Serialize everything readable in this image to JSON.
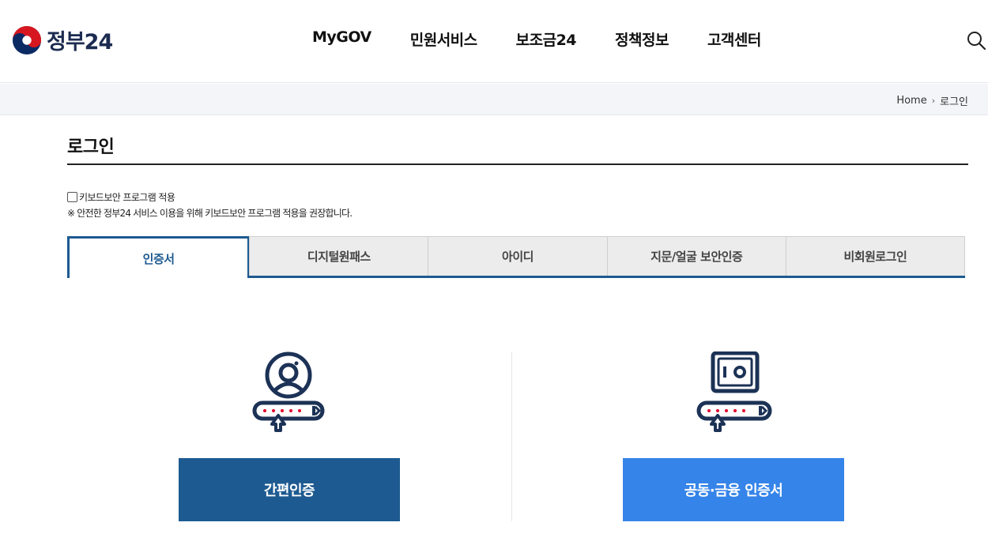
{
  "header": {
    "logo_text": "정부24",
    "nav": [
      "MyGOV",
      "민원서비스",
      "보조금24",
      "정책정보",
      "고객센터"
    ],
    "search_icon": "search-icon"
  },
  "breadcrumb": {
    "home": "Home",
    "separator": "›",
    "current": "로그인"
  },
  "page": {
    "title": "로그인"
  },
  "keyboard_security": {
    "checkbox_label": "키보드보안 프로그램 적용",
    "checked": false,
    "note": "※ 안전한 정부24 서비스 이용을 위해 키보드보안 프로그램 적용을 권장합니다."
  },
  "tabs": [
    "인증서",
    "디지털원패스",
    "아이디",
    "지문/얼굴 보안인증",
    "비회원로그인"
  ],
  "active_tab": "인증서",
  "login_options": {
    "simple_auth": {
      "label": "간편인증",
      "icon": "user-keypad-icon",
      "color": "#1d5a91"
    },
    "public_cert": {
      "label": "공동·금융 인증서",
      "icon": "safe-keypad-icon",
      "color": "#3584e9"
    }
  },
  "colors": {
    "primary": "#1d5a91",
    "accent": "#3584e9",
    "dot_red": "#e4002b",
    "navy": "#1c3256"
  }
}
